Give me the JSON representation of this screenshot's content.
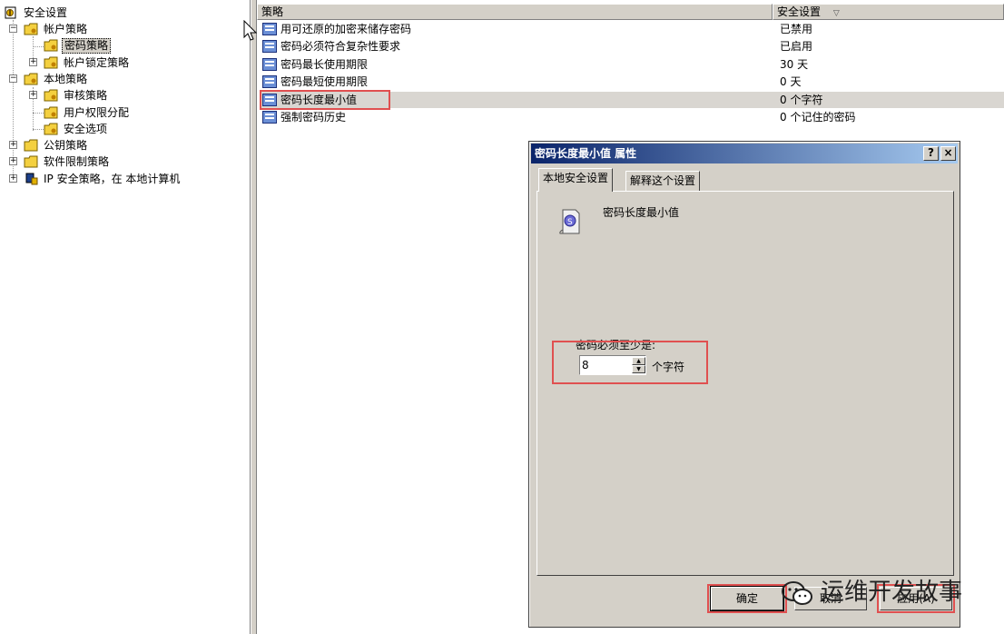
{
  "tree": {
    "root": "安全设置",
    "account_policies": "帐户策略",
    "password_policy": "密码策略",
    "lockout_policy": "帐户锁定策略",
    "local_policies": "本地策略",
    "audit_policy": "审核策略",
    "user_rights": "用户权限分配",
    "security_options": "安全选项",
    "public_key_policies": "公钥策略",
    "software_restriction": "软件限制策略",
    "ip_security": "IP 安全策略，在 本地计算机"
  },
  "list": {
    "col_policy": "策略",
    "col_setting": "安全设置",
    "rows": [
      {
        "name": "用可还原的加密来储存密码",
        "value": "已禁用"
      },
      {
        "name": "密码必须符合复杂性要求",
        "value": "已启用"
      },
      {
        "name": "密码最长使用期限",
        "value": "30 天"
      },
      {
        "name": "密码最短使用期限",
        "value": "0 天"
      },
      {
        "name": "密码长度最小值",
        "value": "0 个字符"
      },
      {
        "name": "强制密码历史",
        "value": "0 个记住的密码"
      }
    ]
  },
  "dialog": {
    "title": "密码长度最小值 属性",
    "help_btn": "?",
    "close_btn": "×",
    "tab_local": "本地安全设置",
    "tab_explain": "解释这个设置",
    "policy_name": "密码长度最小值",
    "min_label": "密码必须至少是:",
    "min_value": "8",
    "unit": "个字符",
    "ok": "确定",
    "cancel": "取消",
    "apply": "应用(A)"
  },
  "watermark": "运维开发故事"
}
